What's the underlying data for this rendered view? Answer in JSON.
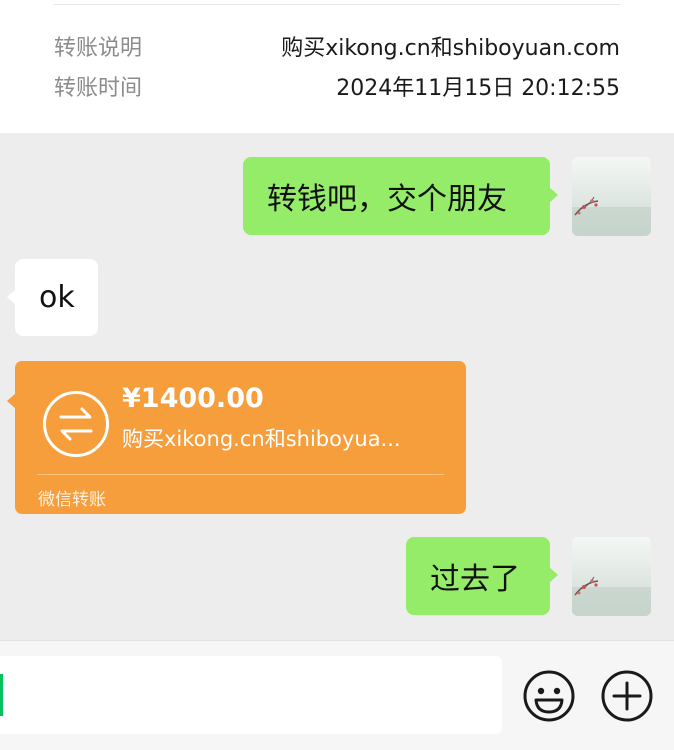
{
  "transfer_info": {
    "note_label": "转账说明",
    "note_value": "购买xikong.cn和shiboyuan.com",
    "time_label": "转账时间",
    "time_value": "2024年11月15日 20:12:55"
  },
  "messages": [
    {
      "side": "right",
      "text": "转钱吧，交个朋友"
    },
    {
      "side": "left",
      "text": "ok"
    },
    {
      "side": "right",
      "text": "过去了"
    }
  ],
  "transfer_card": {
    "amount": "¥1400.00",
    "description": "购买xikong.cn和shiboyua...",
    "footer": "微信转账",
    "color": "#f79e3c"
  },
  "input_bar": {
    "icons": [
      "emoji-icon",
      "plus-icon"
    ]
  },
  "colors": {
    "bubble_self": "#95ec69",
    "bubble_other": "#ffffff",
    "background": "#ededed",
    "caret": "#07c160"
  }
}
